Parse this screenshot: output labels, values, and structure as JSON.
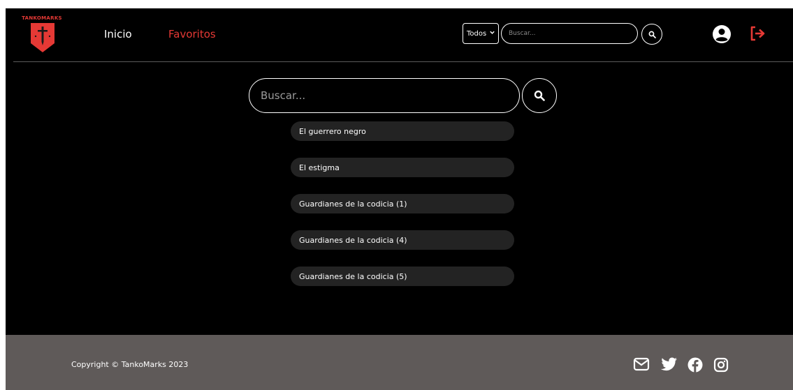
{
  "header": {
    "logo_text": "TANKOMARKS",
    "nav": [
      {
        "label": "Inicio"
      },
      {
        "label": "Favoritos"
      }
    ],
    "filter_value": "Todos",
    "search_placeholder": "Buscar..."
  },
  "main": {
    "search_placeholder": "Buscar...",
    "results": [
      {
        "label": "El guerrero negro"
      },
      {
        "label": "El estigma"
      },
      {
        "label": "Guardianes de la codicia (1)"
      },
      {
        "label": "Guardianes de la codicia (4)"
      },
      {
        "label": "Guardianes de la codicia (5)"
      }
    ]
  },
  "footer": {
    "copyright": "Copyright © TankoMarks 2023"
  },
  "icons": {
    "search": "search-icon",
    "user": "user-icon",
    "logout": "logout-icon",
    "mail": "mail-icon",
    "twitter": "twitter-icon",
    "facebook": "facebook-icon",
    "instagram": "instagram-icon"
  },
  "colors": {
    "accent": "#e53935",
    "background": "#000000",
    "result_bg": "#232323",
    "footer_bg": "#5f5a59"
  }
}
